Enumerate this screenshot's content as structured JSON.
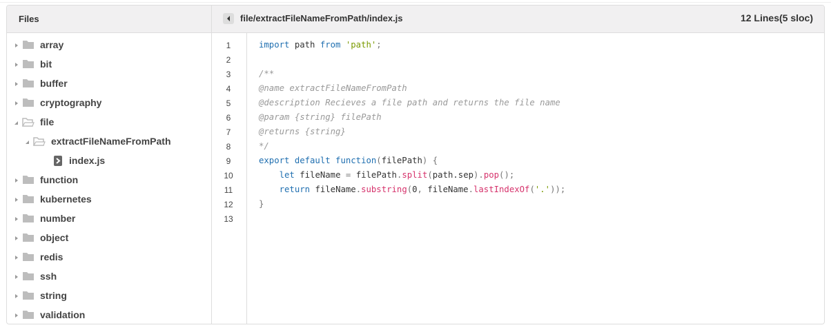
{
  "header": {
    "files_label": "Files",
    "path": "file/extractFileNameFromPath/index.js",
    "line_count": "12 Lines(5 sloc)"
  },
  "tree": [
    {
      "label": "array",
      "type": "folder",
      "open": false,
      "depth": 0
    },
    {
      "label": "bit",
      "type": "folder",
      "open": false,
      "depth": 0
    },
    {
      "label": "buffer",
      "type": "folder",
      "open": false,
      "depth": 0
    },
    {
      "label": "cryptography",
      "type": "folder",
      "open": false,
      "depth": 0
    },
    {
      "label": "file",
      "type": "folder",
      "open": true,
      "depth": 0
    },
    {
      "label": "extractFileNameFromPath",
      "type": "folder",
      "open": true,
      "depth": 1
    },
    {
      "label": "index.js",
      "type": "file",
      "open": false,
      "depth": 2
    },
    {
      "label": "function",
      "type": "folder",
      "open": false,
      "depth": 0
    },
    {
      "label": "kubernetes",
      "type": "folder",
      "open": false,
      "depth": 0
    },
    {
      "label": "number",
      "type": "folder",
      "open": false,
      "depth": 0
    },
    {
      "label": "object",
      "type": "folder",
      "open": false,
      "depth": 0
    },
    {
      "label": "redis",
      "type": "folder",
      "open": false,
      "depth": 0
    },
    {
      "label": "ssh",
      "type": "folder",
      "open": false,
      "depth": 0
    },
    {
      "label": "string",
      "type": "folder",
      "open": false,
      "depth": 0
    },
    {
      "label": "validation",
      "type": "folder",
      "open": false,
      "depth": 0
    }
  ],
  "line_numbers": [
    "1",
    "2",
    "3",
    "4",
    "5",
    "6",
    "7",
    "8",
    "9",
    "10",
    "11",
    "12",
    "13"
  ],
  "code": [
    [
      [
        "kw",
        "import"
      ],
      [
        "id",
        " path "
      ],
      [
        "kw",
        "from"
      ],
      [
        "id",
        " "
      ],
      [
        "str",
        "'path'"
      ],
      [
        "pun",
        ";"
      ]
    ],
    [],
    [
      [
        "cm",
        "/**"
      ]
    ],
    [
      [
        "cm",
        "@name extractFileNameFromPath"
      ]
    ],
    [
      [
        "cm",
        "@description Recieves a file path and returns the file name"
      ]
    ],
    [
      [
        "cm",
        "@param {string} filePath"
      ]
    ],
    [
      [
        "cm",
        "@returns {string}"
      ]
    ],
    [
      [
        "cm",
        "*/"
      ]
    ],
    [
      [
        "kw",
        "export default function"
      ],
      [
        "pun",
        "("
      ],
      [
        "id",
        "filePath"
      ],
      [
        "pun",
        ") {"
      ]
    ],
    [
      [
        "id",
        "    "
      ],
      [
        "kw",
        "let"
      ],
      [
        "id",
        " fileName "
      ],
      [
        "pun",
        "="
      ],
      [
        "id",
        " filePath"
      ],
      [
        "pun",
        "."
      ],
      [
        "fn",
        "split"
      ],
      [
        "pun",
        "("
      ],
      [
        "id",
        "path.sep"
      ],
      [
        "pun",
        ")."
      ],
      [
        "fn",
        "pop"
      ],
      [
        "pun",
        "();"
      ]
    ],
    [
      [
        "id",
        "    "
      ],
      [
        "kw",
        "return"
      ],
      [
        "id",
        " fileName"
      ],
      [
        "pun",
        "."
      ],
      [
        "fn",
        "substring"
      ],
      [
        "pun",
        "("
      ],
      [
        "id",
        "0"
      ],
      [
        "pun",
        ", "
      ],
      [
        "id",
        "fileName"
      ],
      [
        "pun",
        "."
      ],
      [
        "fn",
        "lastIndexOf"
      ],
      [
        "pun",
        "("
      ],
      [
        "str",
        "'.'"
      ],
      [
        "pun",
        "));"
      ]
    ],
    [
      [
        "pun",
        "}"
      ]
    ],
    []
  ],
  "colors": {
    "keyword": "#1f6fb0",
    "string": "#7a9a00",
    "method": "#d6336c",
    "comment": "#999999",
    "folder": "#bdbdbd"
  }
}
